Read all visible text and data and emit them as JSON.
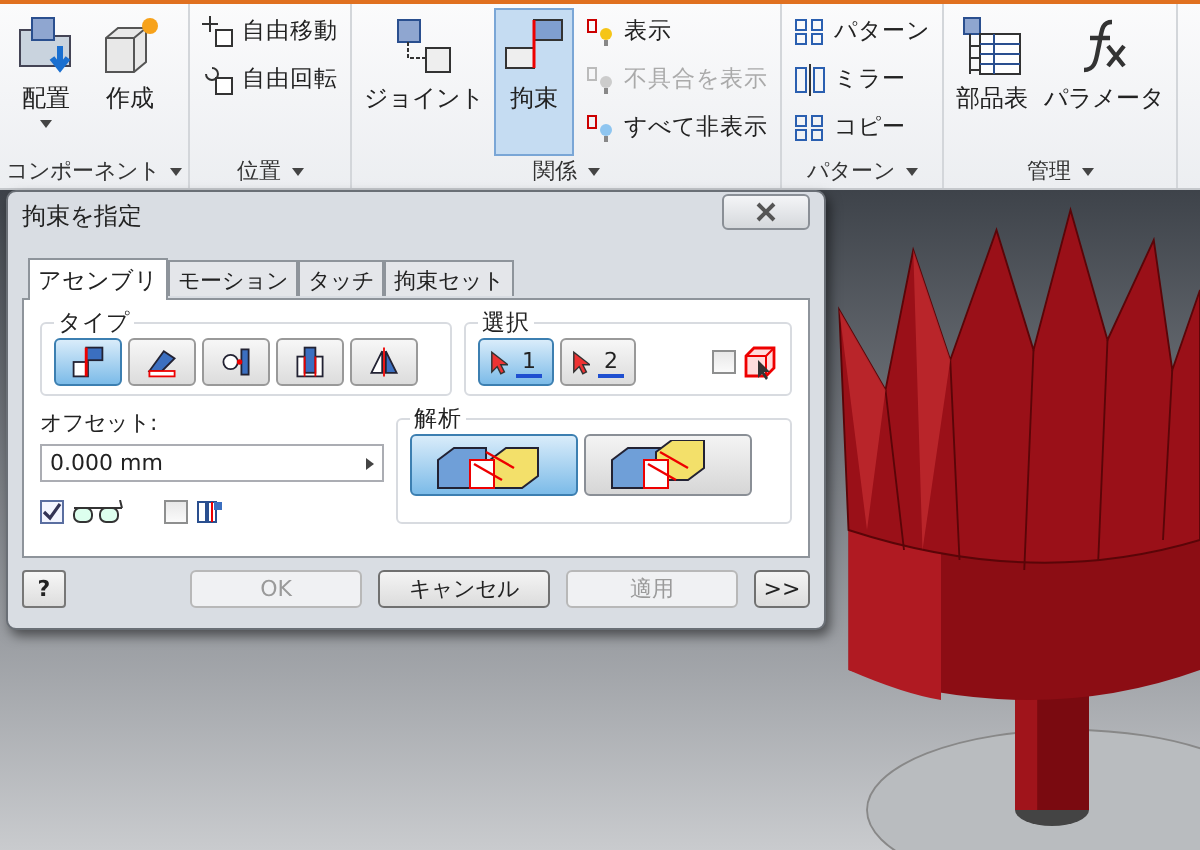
{
  "ribbon": {
    "panels": [
      {
        "title": "コンポーネント",
        "items": [
          {
            "kind": "large",
            "label": "配置",
            "selected": false,
            "disabled": false,
            "dropdown": true
          },
          {
            "kind": "large",
            "label": "作成",
            "selected": false,
            "disabled": false,
            "dropdown": false
          }
        ]
      },
      {
        "title": "位置",
        "items": [
          {
            "kind": "small",
            "label": "自由移動",
            "selected": false,
            "disabled": false
          },
          {
            "kind": "small",
            "label": "自由回転",
            "selected": false,
            "disabled": false
          }
        ]
      },
      {
        "title": "関係",
        "items": [
          {
            "kind": "large",
            "label": "ジョイント",
            "selected": false,
            "disabled": false,
            "dropdown": false
          },
          {
            "kind": "large",
            "label": "拘束",
            "selected": true,
            "disabled": false,
            "dropdown": false
          },
          {
            "kind": "small",
            "label": "表示",
            "selected": false,
            "disabled": false
          },
          {
            "kind": "small",
            "label": "不具合を表示",
            "selected": false,
            "disabled": true
          },
          {
            "kind": "small",
            "label": "すべて非表示",
            "selected": false,
            "disabled": false
          }
        ]
      },
      {
        "title": "パターン",
        "items": [
          {
            "kind": "small",
            "label": "パターン",
            "selected": false,
            "disabled": false
          },
          {
            "kind": "small",
            "label": "ミラー",
            "selected": false,
            "disabled": false
          },
          {
            "kind": "small",
            "label": "コピー",
            "selected": false,
            "disabled": false
          }
        ]
      },
      {
        "title": "管理",
        "items": [
          {
            "kind": "large",
            "label": "部品表",
            "selected": false,
            "disabled": false,
            "dropdown": false
          },
          {
            "kind": "large",
            "label": "パラメータ",
            "selected": false,
            "disabled": false,
            "dropdown": false
          }
        ]
      }
    ]
  },
  "dialog": {
    "title": "拘束を指定",
    "tabs": [
      {
        "label": "アセンブリ",
        "selected": true
      },
      {
        "label": "モーション",
        "selected": false
      },
      {
        "label": "タッチ",
        "selected": false
      },
      {
        "label": "拘束セット",
        "selected": false
      }
    ],
    "type_group": {
      "title": "タイプ",
      "buttons": [
        {
          "selected": true
        },
        {
          "selected": false
        },
        {
          "selected": false
        },
        {
          "selected": false
        },
        {
          "selected": false
        }
      ]
    },
    "selection_group": {
      "title": "選択",
      "buttons": [
        {
          "label": "1",
          "selected": true
        },
        {
          "label": "2",
          "selected": false
        }
      ],
      "checkbox": {
        "checked": false
      }
    },
    "offset": {
      "label": "オフセット:",
      "value": "0.000 mm"
    },
    "options": [
      {
        "checked": true
      },
      {
        "checked": false
      }
    ],
    "analysis_group": {
      "title": "解析",
      "buttons": [
        {
          "selected": true
        },
        {
          "selected": false
        }
      ]
    },
    "help_button": "?",
    "buttons": [
      {
        "label": "OK",
        "disabled": true
      },
      {
        "label": "キャンセル",
        "disabled": false
      },
      {
        "label": "適用",
        "disabled": true
      },
      {
        "label": ">>",
        "disabled": false
      }
    ]
  }
}
